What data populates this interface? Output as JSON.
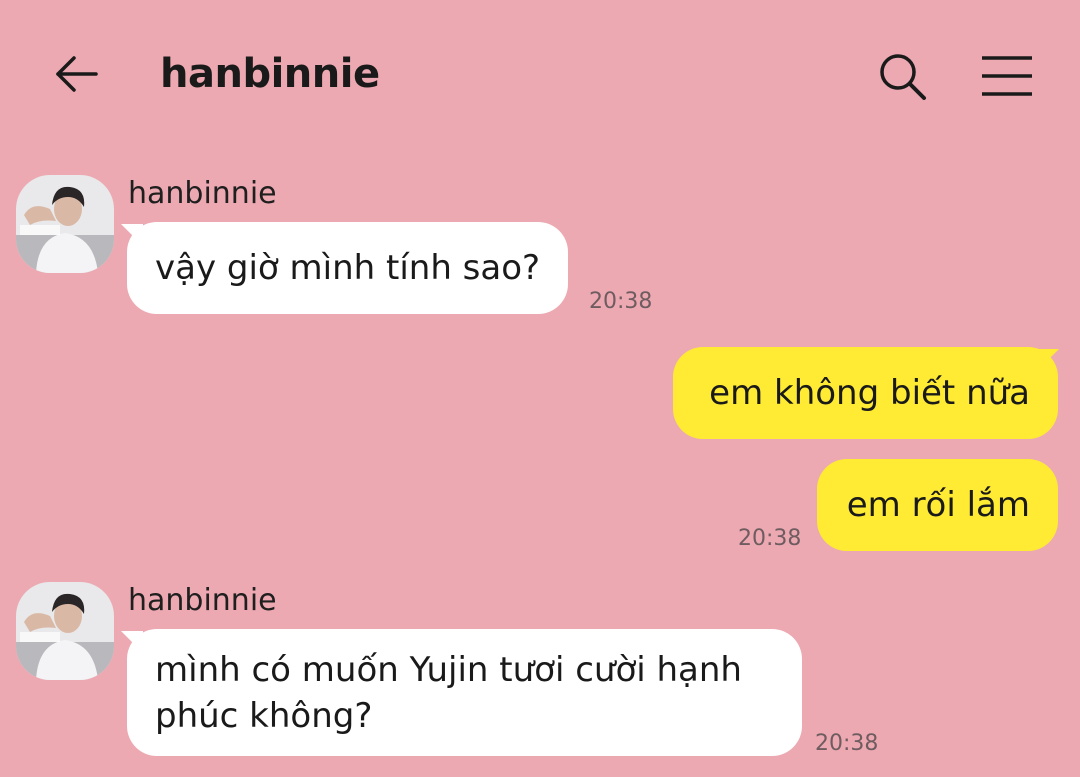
{
  "header": {
    "title": "hanbinnie",
    "back_icon": "arrow-left-icon",
    "search_icon": "search-icon",
    "menu_icon": "hamburger-menu-icon"
  },
  "colors": {
    "background": "#EDA9B1",
    "incoming_bubble": "#FFFFFF",
    "outgoing_bubble": "#FFEB33"
  },
  "messages": [
    {
      "direction": "in",
      "sender": "hanbinnie",
      "text": "vậy giờ mình tính sao?",
      "time": "20:38"
    },
    {
      "direction": "out",
      "text": "em không biết nữa",
      "time": ""
    },
    {
      "direction": "out",
      "text": "em rối lắm",
      "time": "20:38"
    },
    {
      "direction": "in",
      "sender": "hanbinnie",
      "text": "mình có muốn Yujin tươi cười hạnh\nphúc không?",
      "time": "20:38"
    }
  ]
}
